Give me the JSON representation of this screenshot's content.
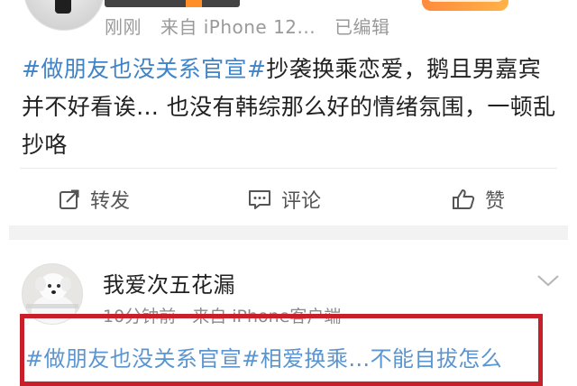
{
  "post1": {
    "meta": {
      "time": "刚刚",
      "source": "来自 iPhone 12...",
      "edited": "已编辑"
    },
    "hashtag1": "#做朋友也没关系官宣#",
    "text_part1": "抄袭换乘恋爱，鹅且男嘉宾并不好看诶… 也没有韩综那么好的情绪氛围，一顿乱抄咯"
  },
  "actions": {
    "repost": "转发",
    "comment": "评论",
    "like": "赞"
  },
  "post2": {
    "username": "我爱次五花漏",
    "meta": {
      "time": "10分钟前",
      "source": "来自 iPhone客户端"
    },
    "partial_text": "#做朋友也没关系官宣#相爱换乘…不能自拔怎么"
  },
  "colors": {
    "hashtag": "#3f83c8",
    "highlight_box": "#c8202a",
    "separator": "#f2f2f2"
  }
}
